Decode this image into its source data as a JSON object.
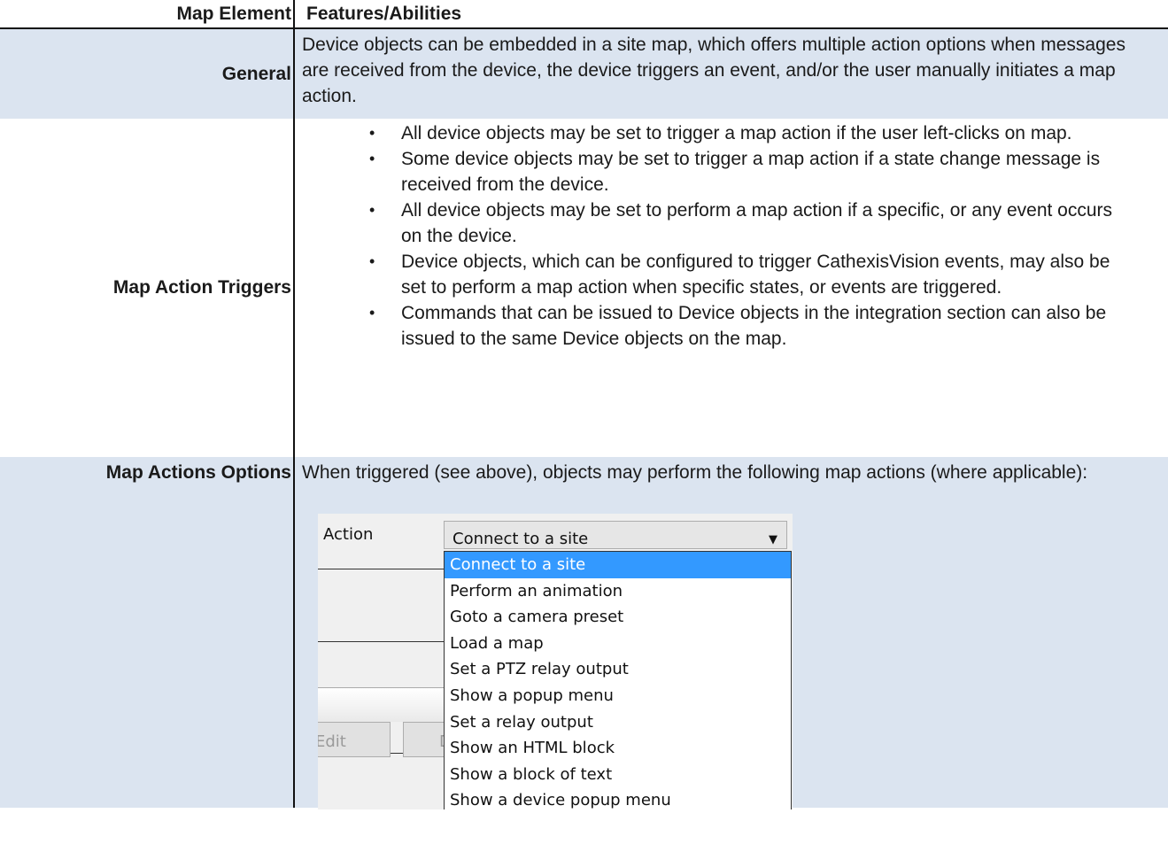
{
  "table": {
    "header": {
      "left": "Map Element",
      "right": "Features/Abilities"
    },
    "general": {
      "label": "General",
      "text": "Device objects can be embedded in a site map, which offers multiple action options when messages are received from the device, the device triggers an event, and/or the user manually initiates a map action."
    },
    "triggers": {
      "label": "Map Action Triggers",
      "bullet": "•",
      "items": [
        "All device objects may be set to trigger a map action if the user left-clicks on map.",
        "Some device objects may be set to trigger a map action if a state change message is received from the device.",
        "All device objects may be set to perform a map action if a specific, or any event occurs on the device.",
        "Device objects, which can be configured to trigger CathexisVision events, may also be set to perform a map action when specific states, or events are triggered.",
        "Commands that can be issued to Device objects in the integration section can also be issued to the same Device objects on the map."
      ]
    },
    "options": {
      "label": "Map Actions Options",
      "intro": "When triggered (see above), objects may perform the following map actions (where applicable):"
    }
  },
  "screenshot": {
    "action_label": "Action",
    "combo_value": "Connect to a site",
    "combo_arrow_icon": "▼",
    "edit_button": "Edit",
    "second_button": "D",
    "dropdown_items": [
      "Connect to a site",
      "Perform an animation",
      "Goto a camera preset",
      "Load a map",
      "Set a PTZ relay output",
      "Show a popup menu",
      "Set a relay output",
      "Show an HTML block",
      "Show a block of text",
      "Show a device popup menu"
    ],
    "selected_index": 0,
    "selected_color": "#3399ff"
  }
}
